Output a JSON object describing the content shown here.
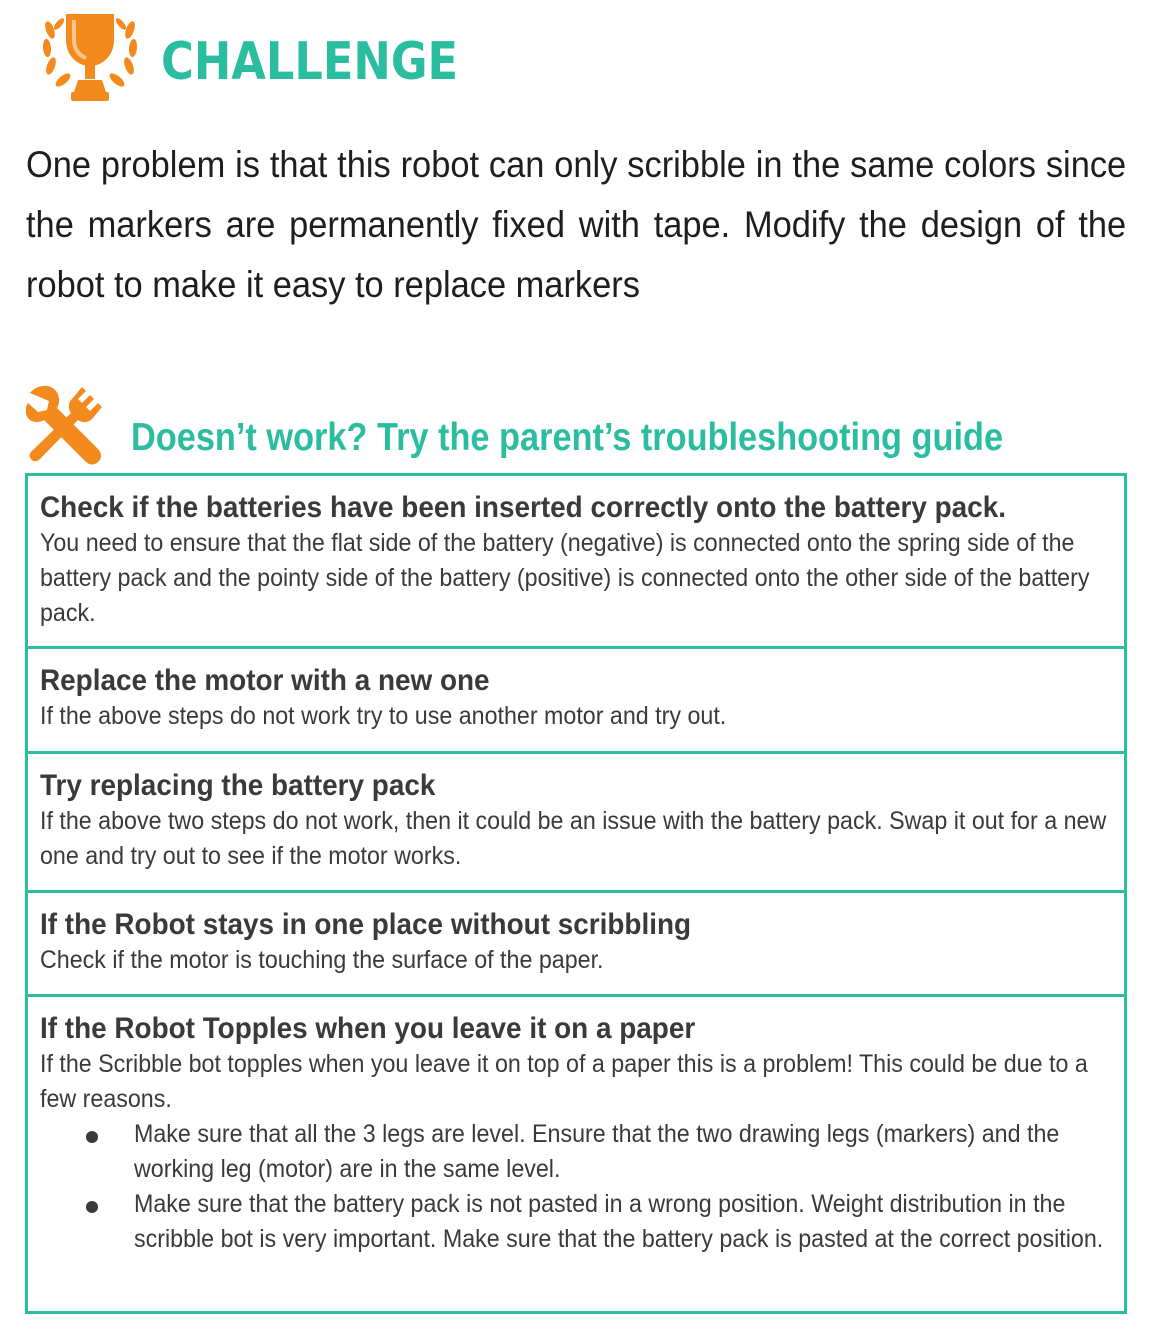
{
  "challenge": {
    "icon": "trophy-icon",
    "title": "CHALLENGE",
    "text": "One problem is that this robot can only scribble in the same colors since the markers are permanently fixed with tape. Modify the design of the robot to make it easy to replace markers"
  },
  "troubleshooting": {
    "icon": "tools-icon",
    "title_bold": "Doesn’t work?",
    "title_rest": " Try the parent’s troubleshooting guide",
    "rows": [
      {
        "title": "Check if the batteries have been inserted correctly onto the battery pack.",
        "text": "You need to ensure that the flat side of the battery (negative) is connected onto the spring side of the battery pack and the pointy side of the battery (positive) is connected onto the other side of the battery pack."
      },
      {
        "title": "Replace the motor with a new one",
        "text": "If the above steps do not work try to use another motor and try out."
      },
      {
        "title": "Try replacing the battery pack",
        "text": "If the above two steps do not work, then it could be an issue with the battery pack. Swap it out for a new one and try out to see if the motor works."
      },
      {
        "title": "If the Robot stays in one place without scribbling",
        "text": "Check if the motor is touching the surface of the paper."
      },
      {
        "title": "If the Robot Topples when you leave it on a paper",
        "text": "If the Scribble bot topples when you leave it on top of a paper this is a problem! This could be due to a few reasons.",
        "bullets": [
          "Make sure that all the 3 legs are level. Ensure that the two drawing legs (markers) and the working leg (motor) are in the same level.",
          "Make sure that the battery pack is not pasted in a wrong position. Weight distribution in the scribble bot is very important. Make sure that the battery pack is pasted at the correct position."
        ]
      }
    ]
  },
  "colors": {
    "accent": "#2bbd9f",
    "icon_orange": "#f28a1d",
    "text": "#3a3a3a"
  }
}
